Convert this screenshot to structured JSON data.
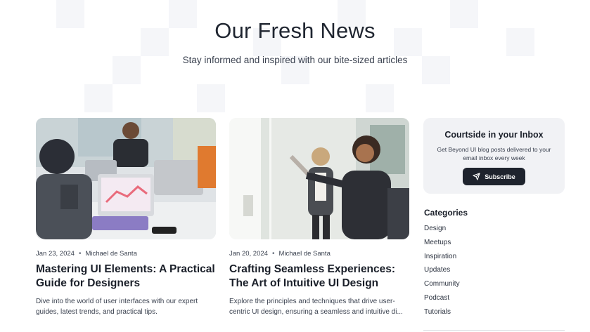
{
  "hero": {
    "title": "Our Fresh News",
    "subtitle": "Stay informed and inspired with our bite-sized articles"
  },
  "articles": [
    {
      "date": "Jan 23, 2024",
      "author": "Michael de Santa",
      "title_line1": "Mastering UI Elements: A Practical",
      "title_line2": "Guide for Designers",
      "excerpt_line1": "Dive into the world of user interfaces with our expert",
      "excerpt_line2": "guides, latest trends, and practical tips.",
      "image": "designers-working-on-laptops-photo"
    },
    {
      "date": "Jan 20, 2024",
      "author": "Michael de Santa",
      "title_line1": "Crafting Seamless Experiences:",
      "title_line2": "The Art of Intuitive UI Design",
      "excerpt_line1": "Explore the principles and techniques that drive user-",
      "excerpt_line2": "centric UI design, ensuring a seamless and intuitive di...",
      "image": "women-at-whiteboard-photo"
    }
  ],
  "meta_separator": "•",
  "newsletter": {
    "title": "Courtside in your Inbox",
    "text": "Get Beyond UI blog posts delivered to your email inbox every week",
    "button_label": "Subscribe",
    "button_icon": "send-icon"
  },
  "categories": {
    "title": "Categories",
    "items": [
      "Design",
      "Meetups",
      "Inspiration",
      "Updates",
      "Community",
      "Podcast",
      "Tutorials"
    ]
  },
  "colors": {
    "text_primary": "#1a1f29",
    "button_bg": "#1e232d",
    "panel_bg": "#f1f2f5"
  }
}
